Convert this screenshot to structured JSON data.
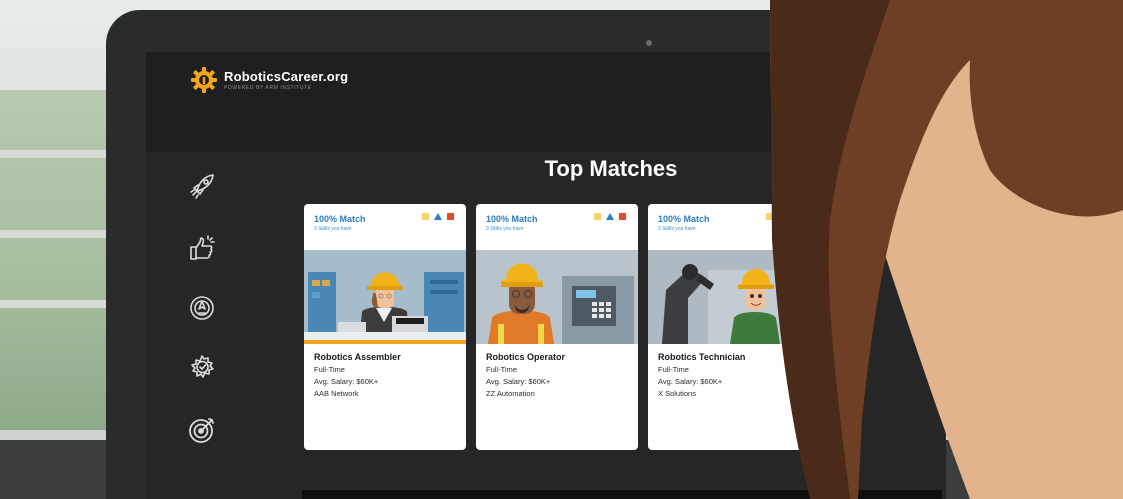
{
  "app": {
    "brand_name": "RoboticsCareer.org",
    "brand_sub": "POWERED BY ARM INSTITUTE",
    "page_title": "Top Matches",
    "accent": "#f2a51a"
  },
  "sidebar": {
    "items": [
      {
        "icon": "rocket-icon"
      },
      {
        "icon": "thumbs-up-icon"
      },
      {
        "icon": "compass-icon"
      },
      {
        "icon": "gear-check-icon"
      },
      {
        "icon": "target-icon"
      }
    ]
  },
  "cards": [
    {
      "match": "100% Match",
      "skills": "3 Skills you have",
      "title": "Robotics Assembler",
      "type": "Full-Time",
      "salary": "Avg. Salary: $60K+",
      "company": "AAB Network"
    },
    {
      "match": "100% Match",
      "skills": "3 Skills you have",
      "title": "Robotics Operator",
      "type": "Full-Time",
      "salary": "Avg. Salary: $60K+",
      "company": "ZZ Automation"
    },
    {
      "match": "100% Match",
      "skills": "3 Skills you have",
      "title": "Robotics Technician",
      "type": "Full-Time",
      "salary": "Avg. Salary: $60K+",
      "company": "X Solutions"
    }
  ],
  "colors": {
    "skill_yellow": "#f6d36a",
    "skill_blue": "#2a7dc1",
    "skill_red": "#e14b2b"
  }
}
